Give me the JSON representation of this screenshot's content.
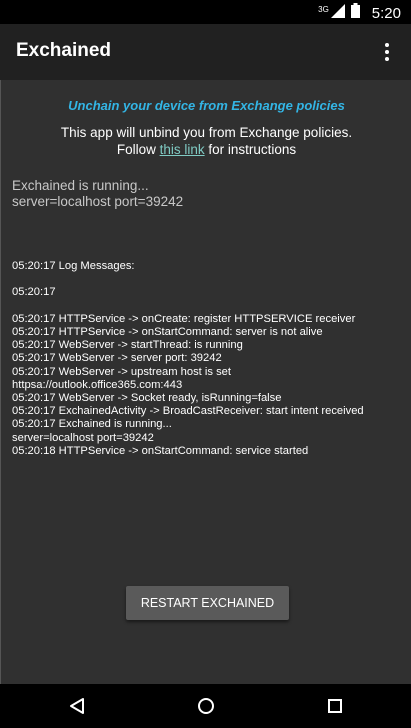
{
  "status_bar": {
    "network": "3G",
    "time": "5:20"
  },
  "app_bar": {
    "title": "Exchained"
  },
  "tagline": "Unchain your device from Exchange policies",
  "intro": {
    "line1": "This app will unbind you from Exchange policies.",
    "line2_before": "Follow ",
    "link_text": "this link",
    "line2_after": " for instructions"
  },
  "running_status": "Exchained is running...\nserver=localhost port=39242",
  "log": [
    "05:20:17 Log Messages:",
    "",
    "05:20:17",
    "",
    "05:20:17 HTTPService -> onCreate: register HTTPSERVICE receiver",
    "05:20:17 HTTPService -> onStartCommand: server is not alive",
    "05:20:17 WebServer -> startThread: is running",
    "05:20:17 WebServer -> server port: 39242",
    "05:20:17 WebServer -> upstream host is set httpsa://outlook.office365.com:443",
    "05:20:17 WebServer -> Socket ready, isRunning=false",
    "05:20:17 ExchainedActivity -> BroadCastReceiver: start intent received",
    "05:20:17 Exchained is running...",
    "server=localhost port=39242",
    "05:20:18 HTTPService -> onStartCommand: service started"
  ],
  "restart_button": "RESTART EXCHAINED",
  "colors": {
    "accent": "#33b5e5",
    "link": "#80cbc4",
    "background": "#303030",
    "app_bar": "#212121",
    "button": "#5a5a5a"
  },
  "icons": [
    "signal-icon",
    "battery-icon",
    "overflow-menu-icon",
    "back-icon",
    "home-icon",
    "recents-icon"
  ]
}
